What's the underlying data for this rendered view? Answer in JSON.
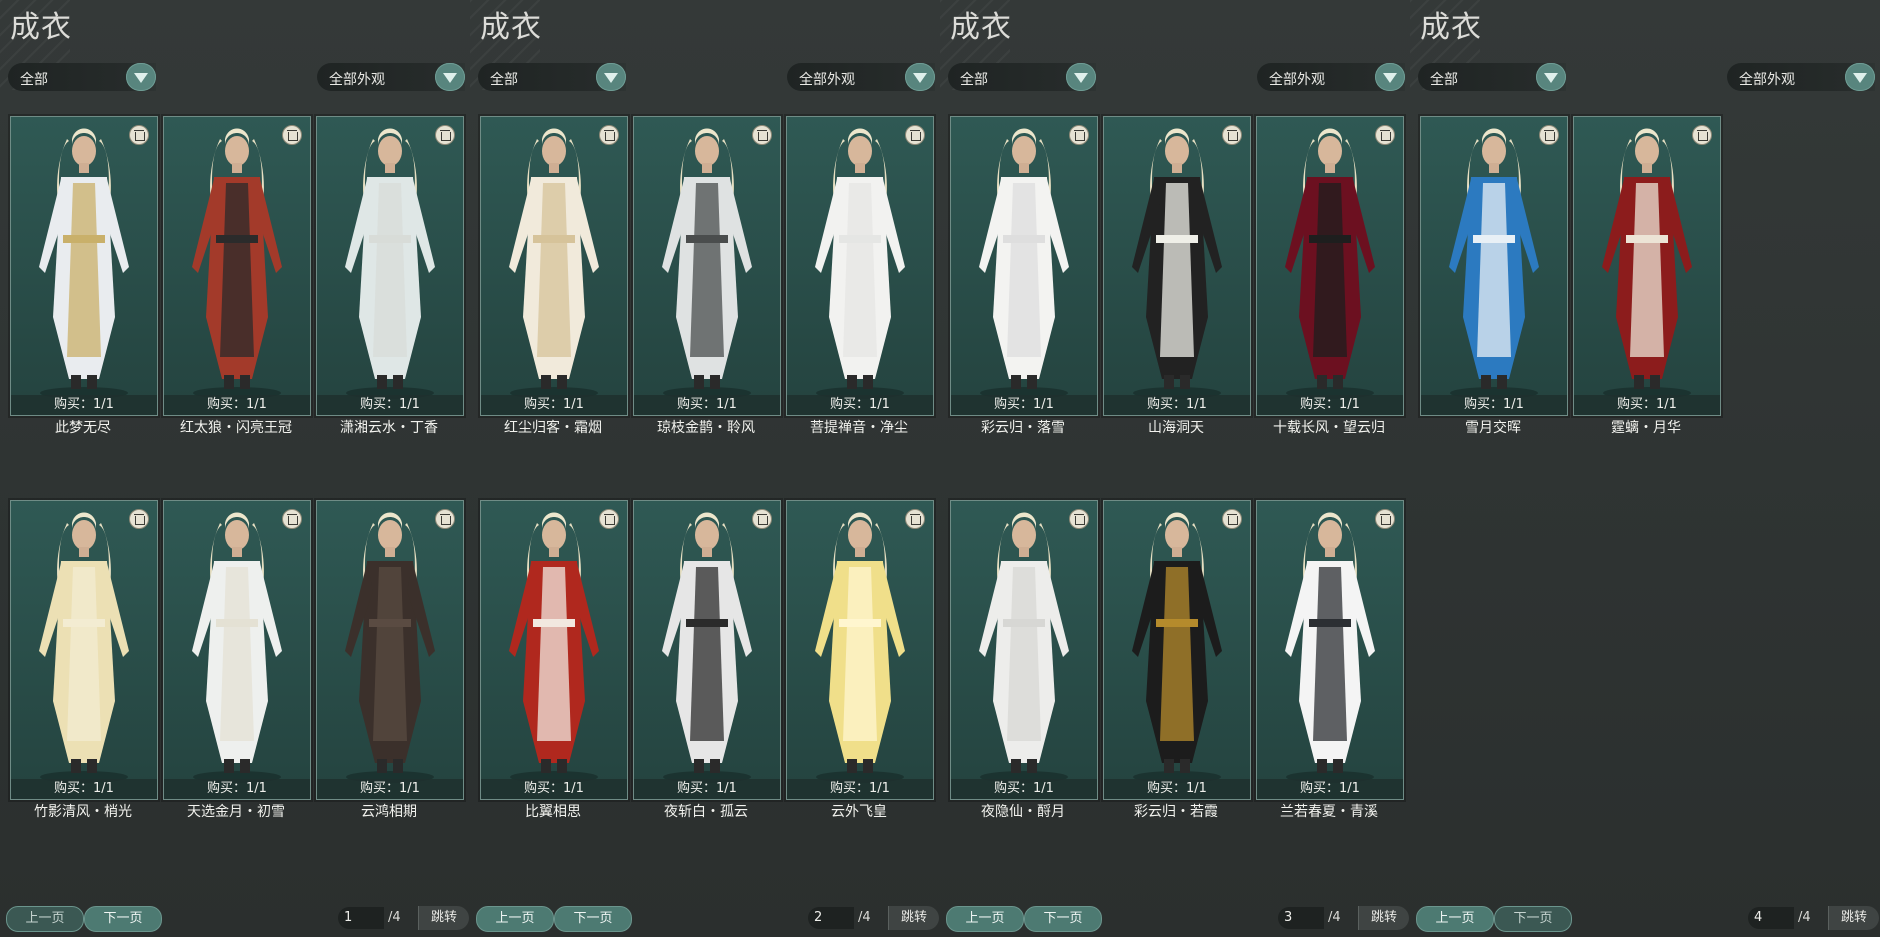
{
  "panels": [
    {
      "title": "成衣",
      "filter_category": "全部",
      "filter_appearance": "全部外观",
      "items": [
        {
          "name": "此梦无尽",
          "purchase": "购买：1/1",
          "colors": [
            "#e9ecef",
            "#c9b06a"
          ]
        },
        {
          "name": "红太狼・闪亮王冠",
          "purchase": "购买：1/1",
          "colors": [
            "#a33a2a",
            "#2b2b2b"
          ]
        },
        {
          "name": "潇湘云水・丁香",
          "purchase": "购买：1/1",
          "colors": [
            "#dfe7e6",
            "#d8dcd8"
          ]
        },
        {
          "name": "竹影清风・梢光",
          "purchase": "购买：1/1",
          "colors": [
            "#ece0b4",
            "#f3ecd2"
          ]
        },
        {
          "name": "天选金月・初雪",
          "purchase": "购买：1/1",
          "colors": [
            "#eef0ee",
            "#e4e1d4"
          ]
        },
        {
          "name": "云鸿相期",
          "purchase": "购买：1/1",
          "colors": [
            "#3b302b",
            "#5a4b42"
          ]
        }
      ],
      "pagination": {
        "prev": "上一页",
        "next": "下一页",
        "page": "1",
        "total": "/4",
        "jump": "跳转"
      }
    },
    {
      "title": "成衣",
      "filter_category": "全部",
      "filter_appearance": "全部外观",
      "items": [
        {
          "name": "红尘归客・霜烟",
          "purchase": "购买：1/1",
          "colors": [
            "#f1eadb",
            "#d6c39a"
          ]
        },
        {
          "name": "琼枝金鹊・聆风",
          "purchase": "购买：1/1",
          "colors": [
            "#dfe2e2",
            "#4a4d4d"
          ]
        },
        {
          "name": "菩提禅音・净尘",
          "purchase": "购买：1/1",
          "colors": [
            "#f2f2f0",
            "#e5e6e4"
          ]
        },
        {
          "name": "比翼相思",
          "purchase": "购买：1/1",
          "colors": [
            "#b0281e",
            "#f2e8e0"
          ]
        },
        {
          "name": "夜斩白・孤云",
          "purchase": "购买：1/1",
          "colors": [
            "#e6e6e6",
            "#2b2b2b"
          ]
        },
        {
          "name": "云外飞皇",
          "purchase": "购买：1/1",
          "colors": [
            "#f0df8a",
            "#fff6cf"
          ]
        }
      ],
      "pagination": {
        "prev": "上一页",
        "next": "下一页",
        "page": "2",
        "total": "/4",
        "jump": "跳转"
      }
    },
    {
      "title": "成衣",
      "filter_category": "全部",
      "filter_appearance": "全部外观",
      "items": [
        {
          "name": "彩云归・落雪",
          "purchase": "购买：1/1",
          "colors": [
            "#f3f3f1",
            "#dedede"
          ]
        },
        {
          "name": "山海洞天",
          "purchase": "购买：1/1",
          "colors": [
            "#222222",
            "#efefe8"
          ]
        },
        {
          "name": "十载长风・望云归",
          "purchase": "购买：1/1",
          "colors": [
            "#6c1020",
            "#1e1e1e"
          ]
        },
        {
          "name": "夜隐仙・酹月",
          "purchase": "购买：1/1",
          "colors": [
            "#ededeb",
            "#d7d7d4"
          ]
        },
        {
          "name": "彩云归・若霞",
          "purchase": "购买：1/1",
          "colors": [
            "#1c1c1c",
            "#b58b2c"
          ]
        },
        {
          "name": "兰若春夏・青溪",
          "purchase": "购买：1/1",
          "colors": [
            "#f4f4f4",
            "#2c2f33"
          ]
        }
      ],
      "pagination": {
        "prev": "上一页",
        "next": "下一页",
        "page": "3",
        "total": "/4",
        "jump": "跳转"
      }
    },
    {
      "title": "成衣",
      "filter_category": "全部",
      "filter_appearance": "全部外观",
      "items": [
        {
          "name": "雪月交晖",
          "purchase": "购买：1/1",
          "colors": [
            "#2c7ac0",
            "#e8f0f6"
          ]
        },
        {
          "name": "霆螭・月华",
          "purchase": "购买：1/1",
          "colors": [
            "#8c1c1c",
            "#ece4d6"
          ]
        }
      ],
      "pagination": {
        "prev": "上一页",
        "next": "下一页",
        "page": "4",
        "total": "/4",
        "jump": "跳转"
      }
    }
  ]
}
